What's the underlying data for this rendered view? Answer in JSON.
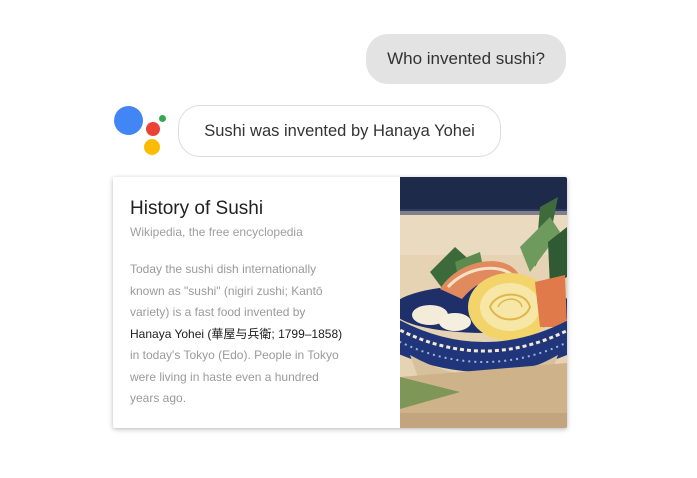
{
  "conversation": {
    "user_query": "Who invented sushi?",
    "assistant_reply": "Sushi was invented by Hanaya Yohei"
  },
  "assistant_logo": {
    "icon": "google-assistant-logo",
    "colors": [
      "#4285f4",
      "#ea4335",
      "#34a853",
      "#fbbc05"
    ]
  },
  "card": {
    "title": "History of Sushi",
    "source": "Wikipedia, the free encyclopedia",
    "body_lines": [
      "Today the sushi dish internationally",
      "known as \"sushi\" (nigiri zushi; Kantō",
      "variety) is a fast food invented by",
      "Hanaya Yohei (華屋与兵衛; 1799–1858)",
      "in today's Tokyo (Edo). People in Tokyo",
      "were living in haste even a hundred",
      "years ago."
    ],
    "image": "sushi-woodblock-print-image"
  }
}
